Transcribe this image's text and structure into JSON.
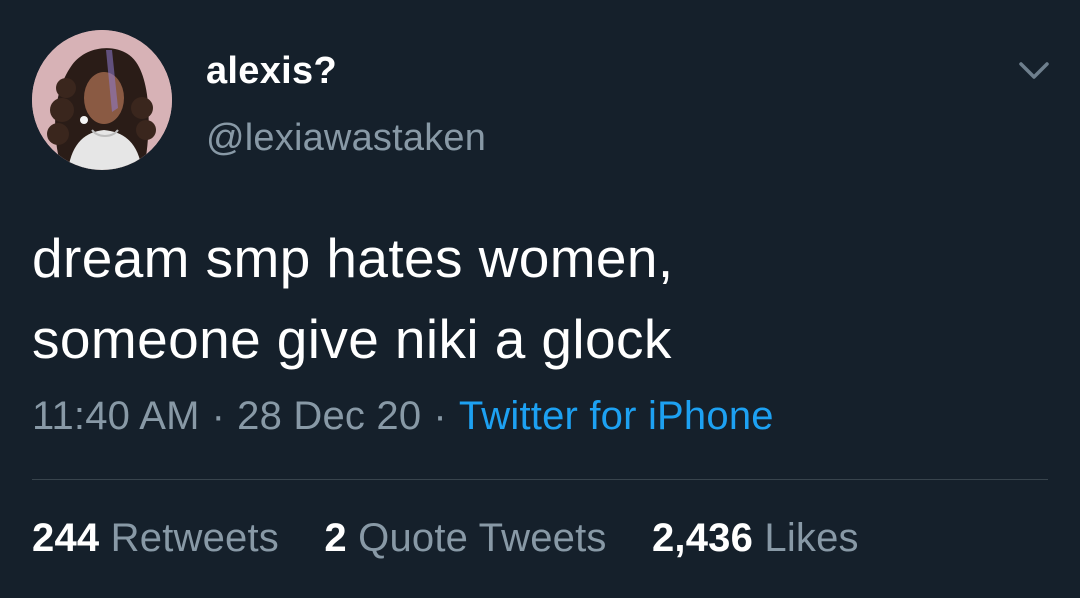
{
  "colors": {
    "background": "#15202b",
    "primary_text": "#ffffff",
    "secondary_text": "#8899a6",
    "link": "#1da1f2",
    "divider": "#38444d"
  },
  "user": {
    "display_name": "alexis?",
    "handle": "@lexiawastaken",
    "avatar_icon": "profile-avatar"
  },
  "more_menu_icon": "chevron-down-icon",
  "tweet": {
    "lines": [
      "dream smp hates women,",
      "someone give niki a glock"
    ],
    "time": "11:40 AM",
    "separator": "·",
    "date": "28 Dec 20",
    "source": "Twitter for iPhone"
  },
  "stats": [
    {
      "count": "244",
      "label": "Retweets"
    },
    {
      "count": "2",
      "label": "Quote Tweets"
    },
    {
      "count": "2,436",
      "label": "Likes"
    }
  ]
}
